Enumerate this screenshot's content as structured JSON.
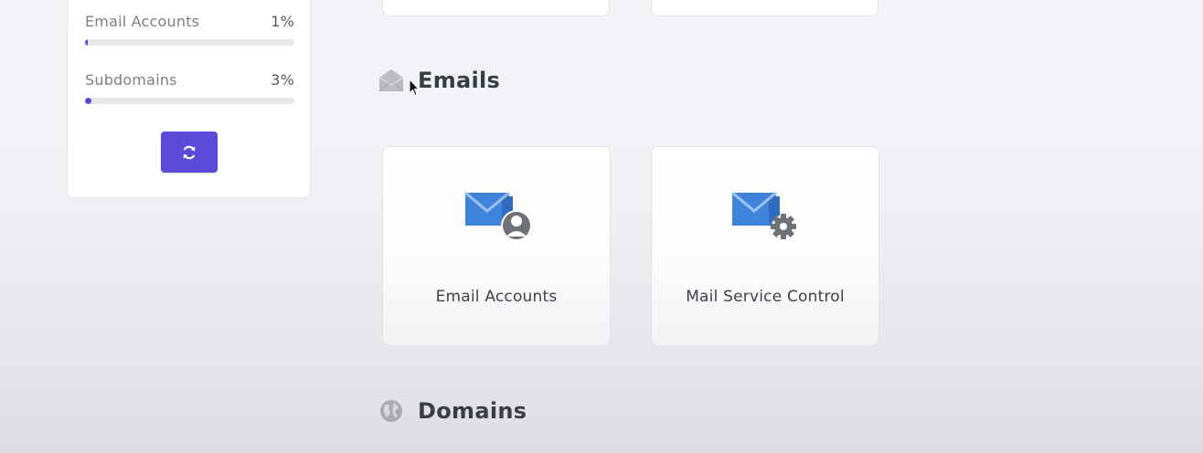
{
  "sidebar_stats": {
    "items": [
      {
        "label": "Email Accounts",
        "percent_text": "1%",
        "progress": 0.01
      },
      {
        "label": "Subdomains",
        "percent_text": "3%",
        "progress": 0.03
      }
    ],
    "refresh_icon": "refresh-icon"
  },
  "sections": {
    "emails": {
      "title": "Emails",
      "icon": "envelope-open-icon",
      "tools": [
        {
          "label": "Email Accounts",
          "icon": "email-accounts-icon"
        },
        {
          "label": "Mail Service Control",
          "icon": "mail-service-control-icon"
        }
      ]
    },
    "domains": {
      "title": "Domains",
      "icon": "globe-icon"
    }
  },
  "colors": {
    "accent": "#5b4ad8",
    "envelope_blue": "#3f83dd",
    "icon_gray": "#8a8d92"
  }
}
